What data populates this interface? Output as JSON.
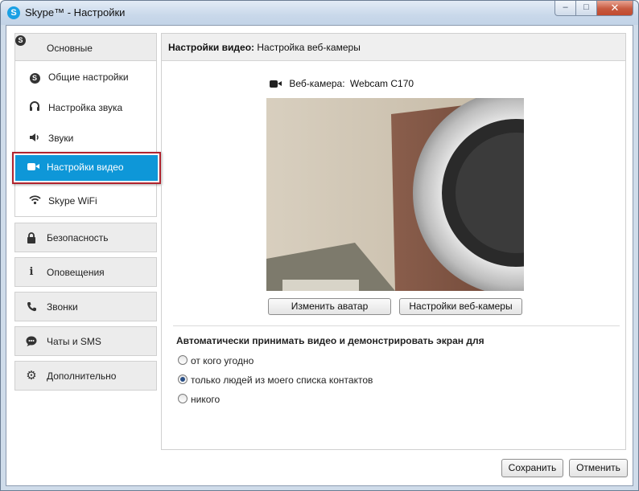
{
  "window": {
    "title": "Skype™ - Настройки",
    "app_icon_letter": "S",
    "min_label": "–",
    "max_label": "□",
    "close_label": "✕"
  },
  "sidebar": {
    "groups_top": {
      "label": "Основные",
      "icon": "skype-icon"
    },
    "sub_items": [
      {
        "label": "Общие настройки",
        "icon": "skype-icon"
      },
      {
        "label": "Настройка звука",
        "icon": "headset-icon"
      },
      {
        "label": "Звуки",
        "icon": "speaker-icon"
      },
      {
        "label": "Настройки видео",
        "icon": "camera-icon",
        "active": true
      },
      {
        "label": "Skype WiFi",
        "icon": "wifi-icon"
      }
    ],
    "groups": [
      {
        "label": "Безопасность",
        "icon": "lock-icon"
      },
      {
        "label": "Оповещения",
        "icon": "info-icon"
      },
      {
        "label": "Звонки",
        "icon": "phone-icon"
      },
      {
        "label": "Чаты и SMS",
        "icon": "chat-icon"
      },
      {
        "label": "Дополнительно",
        "icon": "gear-icon"
      }
    ]
  },
  "main": {
    "header_bold": "Настройки видео:",
    "header_rest": "Настройка веб-камеры",
    "webcam_label": "Веб-камера:",
    "webcam_name": "Webcam C170",
    "change_avatar": "Изменить аватар",
    "webcam_settings": "Настройки веб-камеры",
    "auto_title": "Автоматически принимать видео и демонстрировать экран для",
    "radios": [
      {
        "label": "от кого угодно",
        "checked": false
      },
      {
        "label": "только людей из моего списка контактов",
        "checked": true
      },
      {
        "label": "никого",
        "checked": false
      }
    ]
  },
  "footer": {
    "save": "Сохранить",
    "cancel": "Отменить"
  },
  "colors": {
    "active_item": "#0e97d8",
    "highlight_border": "#b0242f",
    "skype_blue": "#1aa0e4"
  }
}
